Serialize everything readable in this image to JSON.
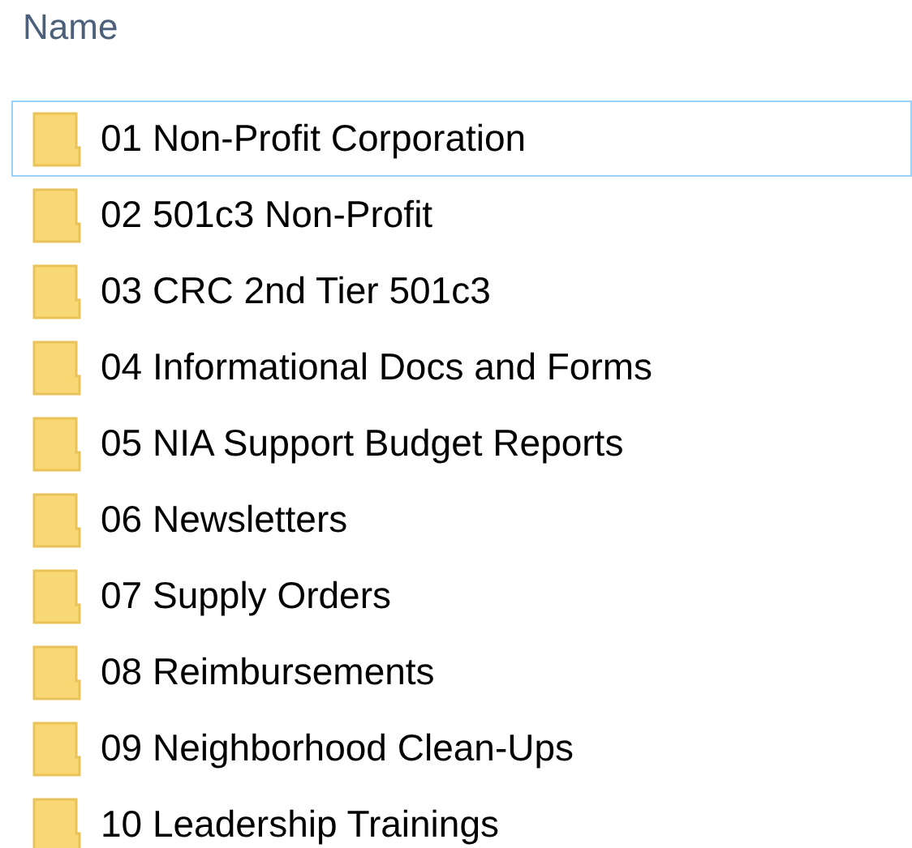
{
  "header": {
    "column": "Name"
  },
  "items": [
    {
      "name": "01 Non-Profit Corporation",
      "focused": true
    },
    {
      "name": "02 501c3 Non-Profit",
      "focused": false
    },
    {
      "name": "03 CRC 2nd Tier 501c3",
      "focused": false
    },
    {
      "name": "04 Informational Docs and Forms",
      "focused": false
    },
    {
      "name": "05 NIA Support Budget Reports",
      "focused": false
    },
    {
      "name": "06 Newsletters",
      "focused": false
    },
    {
      "name": "07 Supply Orders",
      "focused": false
    },
    {
      "name": "08 Reimbursements",
      "focused": false
    },
    {
      "name": "09 Neighborhood Clean-Ups",
      "focused": false
    },
    {
      "name": "10 Leadership Trainings",
      "focused": false
    }
  ]
}
